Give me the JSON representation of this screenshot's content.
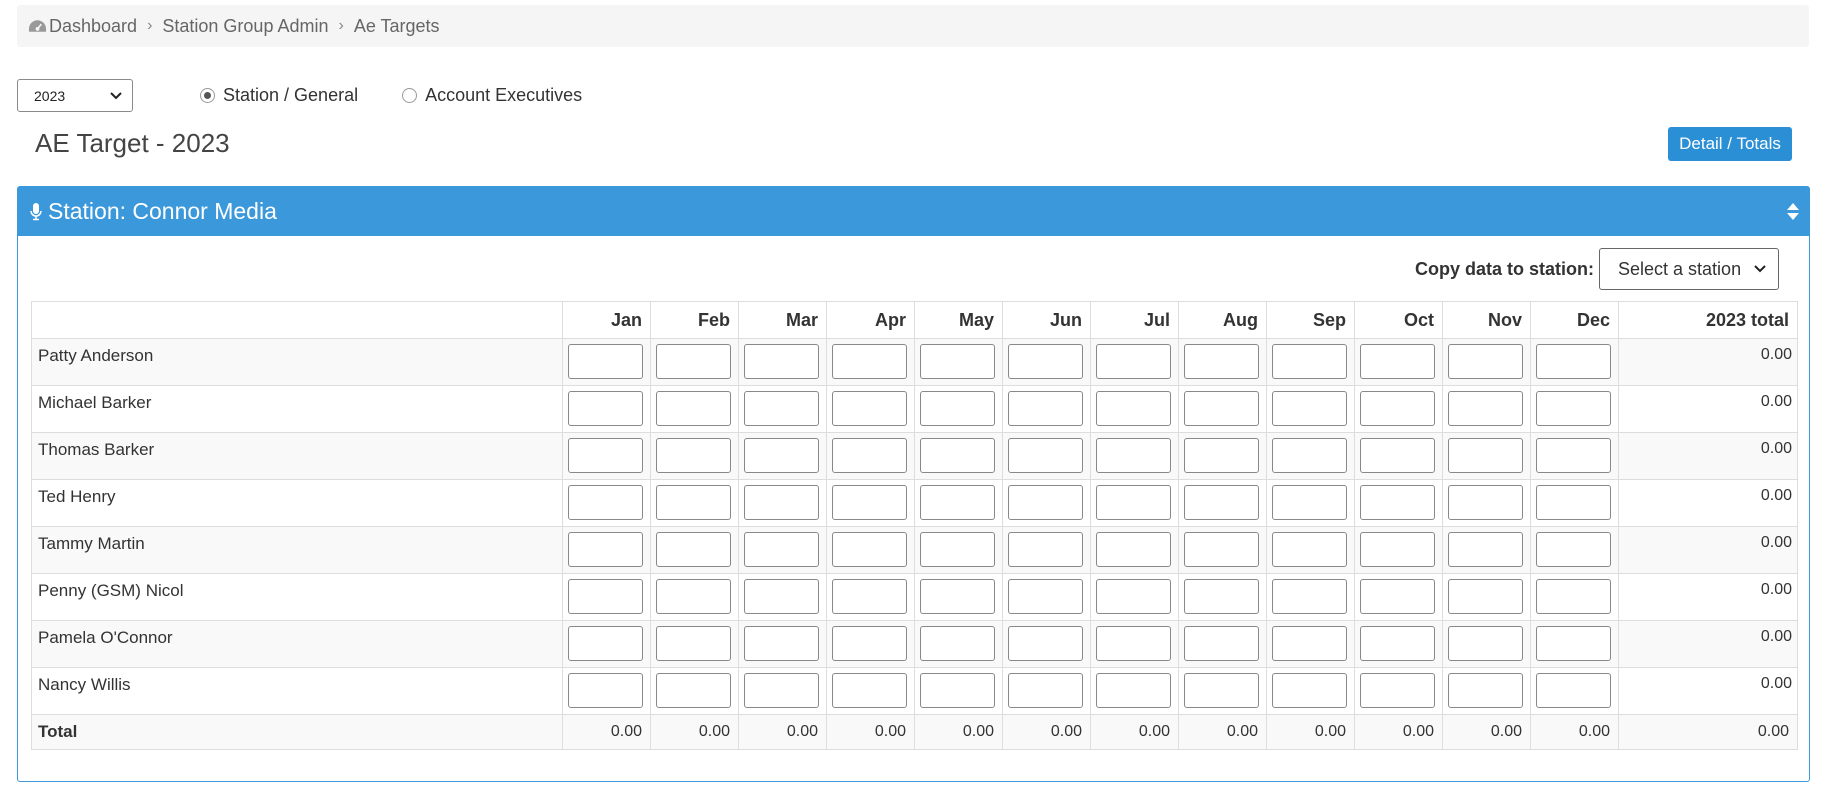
{
  "breadcrumb": {
    "items": [
      {
        "label": "Dashboard"
      },
      {
        "label": "Station Group Admin"
      },
      {
        "label": "Ae Targets"
      }
    ]
  },
  "controls": {
    "year": "2023",
    "radio_station": "Station / General",
    "radio_ae": "Account Executives",
    "selected": "station"
  },
  "page": {
    "title": "AE Target - 2023",
    "detail_button": "Detail / Totals"
  },
  "panel": {
    "title": "Station: Connor Media",
    "copy_label": "Copy data to station:",
    "copy_placeholder": "Select a station"
  },
  "table": {
    "months": [
      "Jan",
      "Feb",
      "Mar",
      "Apr",
      "May",
      "Jun",
      "Jul",
      "Aug",
      "Sep",
      "Oct",
      "Nov",
      "Dec"
    ],
    "total_header": "2023 total",
    "rows": [
      {
        "name": "Patty Anderson",
        "total": "0.00"
      },
      {
        "name": "Michael Barker",
        "total": "0.00"
      },
      {
        "name": "Thomas Barker",
        "total": "0.00"
      },
      {
        "name": "Ted Henry",
        "total": "0.00"
      },
      {
        "name": "Tammy Martin",
        "total": "0.00"
      },
      {
        "name": "Penny (GSM) Nicol",
        "total": "0.00"
      },
      {
        "name": "Pamela O'Connor",
        "total": "0.00"
      },
      {
        "name": "Nancy Willis",
        "total": "0.00"
      }
    ],
    "totals": {
      "label": "Total",
      "values": [
        "0.00",
        "0.00",
        "0.00",
        "0.00",
        "0.00",
        "0.00",
        "0.00",
        "0.00",
        "0.00",
        "0.00",
        "0.00",
        "0.00"
      ],
      "grand": "0.00"
    }
  },
  "colors": {
    "accent": "#3a98db",
    "button": "#2b8fd6"
  },
  "icons": {
    "breadcrumb_home": "dashboard-gauge-icon",
    "panel": "microphone-icon",
    "panel_toggle": "sort-icon"
  }
}
